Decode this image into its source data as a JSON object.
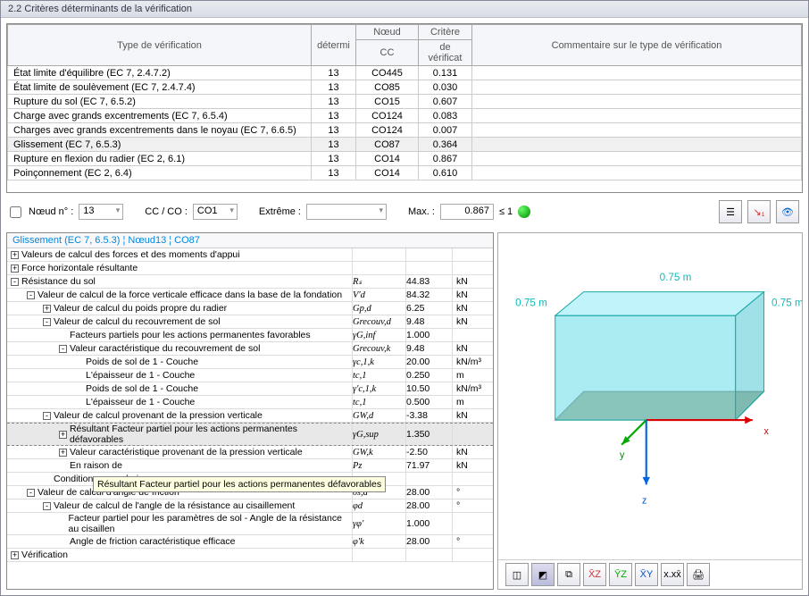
{
  "title": "2.2 Critères déterminants de la vérification",
  "table": {
    "headers": {
      "type": "Type de vérification",
      "determi": "détermi",
      "noeud_grp": "Nœud",
      "cc": "CC",
      "crit_grp": "Critère",
      "crit": "de vérificat",
      "comment": "Commentaire sur le type de vérification"
    },
    "rows": [
      {
        "type": "État limite d'équilibre (EC 7, 2.4.7.2)",
        "det": "13",
        "cc": "CO445",
        "crit": "0.131"
      },
      {
        "type": "État limite de soulèvement (EC 7, 2.4.7.4)",
        "det": "13",
        "cc": "CO85",
        "crit": "0.030"
      },
      {
        "type": "Rupture du sol (EC 7, 6.5.2)",
        "det": "13",
        "cc": "CO15",
        "crit": "0.607"
      },
      {
        "type": "Charge avec grands excentrements (EC 7, 6.5.4)",
        "det": "13",
        "cc": "CO124",
        "crit": "0.083"
      },
      {
        "type": "Charges avec grands excentrements dans le noyau (EC 7, 6.6.5)",
        "det": "13",
        "cc": "CO124",
        "crit": "0.007"
      },
      {
        "type": "Glissement (EC 7, 6.5.3)",
        "det": "13",
        "cc": "CO87",
        "crit": "0.364"
      },
      {
        "type": "Rupture en flexion du radier (EC 2, 6.1)",
        "det": "13",
        "cc": "CO14",
        "crit": "0.867"
      },
      {
        "type": "Poinçonnement (EC 2, 6.4)",
        "det": "13",
        "cc": "CO14",
        "crit": "0.610"
      }
    ]
  },
  "controls": {
    "noeud_label": "Nœud n° :",
    "noeud_val": "13",
    "ccco_label": "CC / CO :",
    "ccco_val": "CO1",
    "extreme_label": "Extrême :",
    "extreme_val": "",
    "max_label": "Max. :",
    "max_val": "0.867",
    "max_cond": "≤ 1"
  },
  "detail": {
    "title": "Glissement (EC 7, 6.5.3) ¦ Nœud13 ¦ CO87",
    "rows": [
      {
        "ind": 0,
        "tog": "+",
        "lbl": "Valeurs de calcul des forces et des moments d'appui"
      },
      {
        "ind": 0,
        "tog": "+",
        "lbl": "Force horizontale résultante"
      },
      {
        "ind": 0,
        "tog": "-",
        "lbl": "Résistance du sol",
        "sym": "Rₛ",
        "val": "44.83",
        "unit": "kN"
      },
      {
        "ind": 1,
        "tog": "-",
        "lbl": "Valeur de calcul de la force verticale efficace dans la base de la fondation",
        "sym": "V'd",
        "val": "84.32",
        "unit": "kN"
      },
      {
        "ind": 2,
        "tog": "+",
        "lbl": "Valeur de calcul du poids propre du radier",
        "sym": "Gp,d",
        "val": "6.25",
        "unit": "kN"
      },
      {
        "ind": 2,
        "tog": "-",
        "lbl": "Valeur de calcul du recouvrement de sol",
        "sym": "Grecouv,d",
        "val": "9.48",
        "unit": "kN"
      },
      {
        "ind": 3,
        "tog": "",
        "lbl": "Facteurs partiels pour les actions permanentes favorables",
        "sym": "γG,inf",
        "val": "1.000",
        "unit": ""
      },
      {
        "ind": 3,
        "tog": "-",
        "lbl": "Valeur caractéristique du recouvrement de sol",
        "sym": "Grecouv,k",
        "val": "9.48",
        "unit": "kN"
      },
      {
        "ind": 4,
        "tog": "",
        "lbl": "Poids de sol de 1 - Couche",
        "sym": "γc,1,k",
        "val": "20.00",
        "unit": "kN/m³"
      },
      {
        "ind": 4,
        "tog": "",
        "lbl": "L'épaisseur de 1 - Couche",
        "sym": "tc,1",
        "val": "0.250",
        "unit": "m"
      },
      {
        "ind": 4,
        "tog": "",
        "lbl": "Poids de sol de 1 - Couche",
        "sym": "γ'c,1,k",
        "val": "10.50",
        "unit": "kN/m³"
      },
      {
        "ind": 4,
        "tog": "",
        "lbl": "L'épaisseur de 1 - Couche",
        "sym": "tc,1",
        "val": "0.500",
        "unit": "m"
      },
      {
        "ind": 2,
        "tog": "-",
        "lbl": "Valeur de calcul provenant de la pression verticale",
        "sym": "GW,d",
        "val": "-3.38",
        "unit": "kN"
      },
      {
        "ind": 3,
        "tog": "+",
        "lbl": "Résultant Facteur partiel pour les actions permanentes défavorables",
        "sym": "γG,sup",
        "val": "1.350",
        "unit": "",
        "hl": true
      },
      {
        "ind": 3,
        "tog": "+",
        "lbl": "Valeur caractéristique provenant de la pression verticale",
        "sym": "GW,k",
        "val": "-2.50",
        "unit": "kN"
      },
      {
        "ind": 3,
        "tog": "",
        "lbl": "En raison de",
        "sym": "Pz",
        "val": "71.97",
        "unit": "kN"
      },
      {
        "ind": 2,
        "tog": "",
        "lbl": "Conditions avec drainage"
      },
      {
        "ind": 1,
        "tog": "-",
        "lbl": "Valeur de calcul d'angle de friction",
        "sym": "δs,d",
        "val": "28.00",
        "unit": "°"
      },
      {
        "ind": 2,
        "tog": "-",
        "lbl": "Valeur de calcul de l'angle de la résistance au cisaillement",
        "sym": "φd",
        "val": "28.00",
        "unit": "°"
      },
      {
        "ind": 3,
        "tog": "",
        "lbl": "Facteur partiel pour les paramètres de sol - Angle de la résistance au cisaillen",
        "sym": "γφ'",
        "val": "1.000",
        "unit": ""
      },
      {
        "ind": 3,
        "tog": "",
        "lbl": "Angle de friction caractéristique efficace",
        "sym": "φ'k",
        "val": "28.00",
        "unit": "°"
      },
      {
        "ind": 0,
        "tog": "+",
        "lbl": "Vérification"
      }
    ],
    "tooltip": "Résultant Facteur partiel pour les actions permanentes défavorables"
  },
  "viewer": {
    "dim1": "0.75 m",
    "dim2": "0.75 m",
    "dim3": "0.75 m",
    "axes": {
      "x": "x",
      "y": "y",
      "z": "z"
    },
    "toolbar": [
      "iso1",
      "iso2",
      "persp",
      "xz",
      "yz",
      "xy",
      "xxx",
      "print"
    ]
  }
}
